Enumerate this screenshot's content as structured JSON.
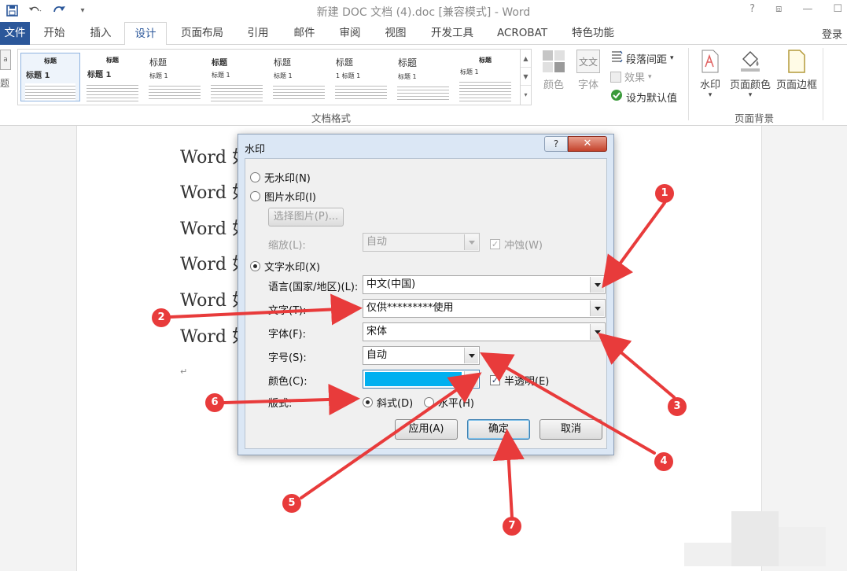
{
  "window": {
    "title": "新建 DOC 文档 (4).doc [兼容模式] - Word",
    "controls": [
      "?",
      "⧈",
      "—",
      "☐"
    ]
  },
  "tabs": {
    "file": "文件",
    "items": [
      "开始",
      "插入",
      "设计",
      "页面布局",
      "引用",
      "邮件",
      "审阅",
      "视图",
      "开发工具",
      "ACROBAT",
      "特色功能"
    ],
    "active": "设计",
    "login": "登录"
  },
  "ribbon": {
    "left_cut_label": "题",
    "gallery_titles": [
      "标题",
      "标题",
      "标题",
      "标题",
      "标题",
      "标题",
      "标题",
      "标题"
    ],
    "gallery_subtitles": [
      "标题 1",
      "标题 1",
      "标题 1",
      "标题 1",
      "标题 1",
      "1 标题 1",
      "标题 1",
      "标题 1"
    ],
    "doc_format_label": "文档格式",
    "color_label": "颜色",
    "font_label": "字体",
    "font_icon_text": "文文",
    "paragraph_spacing": "段落间距",
    "effects": "效果",
    "set_default": "设为默认值",
    "watermark": "水印",
    "page_color": "页面颜色",
    "page_border": "页面边框",
    "page_background_label": "页面背景"
  },
  "document": {
    "lines": [
      "Word 如",
      "Word 如",
      "Word 如",
      "Word 如",
      "Word 如",
      "Word 如"
    ],
    "para_mark": "↵"
  },
  "dialog": {
    "title": "水印",
    "help": "?",
    "close": "✕",
    "no_watermark": "无水印(N)",
    "picture_watermark": "图片水印(I)",
    "select_picture": "选择图片(P)...",
    "scale_label": "缩放(L):",
    "scale_value": "自动",
    "washout": "冲蚀(W)",
    "text_watermark": "文字水印(X)",
    "language_label": "语言(国家/地区)(L):",
    "language_value": "中文(中国)",
    "text_label": "文字(T):",
    "text_value": "仅供*********使用",
    "font_label": "字体(F):",
    "font_value": "宋体",
    "size_label": "字号(S):",
    "size_value": "自动",
    "color_label": "颜色(C):",
    "color_value": "#00b0f0",
    "semitransparent": "半透明(E)",
    "layout_label": "版式:",
    "diagonal": "斜式(D)",
    "horizontal": "水平(H)",
    "apply": "应用(A)",
    "ok": "确定",
    "cancel": "取消",
    "selected_option": "text_watermark",
    "selected_layout": "diagonal",
    "semitransparent_checked": true,
    "washout_checked": true
  },
  "annotations": {
    "color": "#e83b3b",
    "badges": [
      "1",
      "2",
      "3",
      "4",
      "5",
      "6",
      "7"
    ]
  }
}
